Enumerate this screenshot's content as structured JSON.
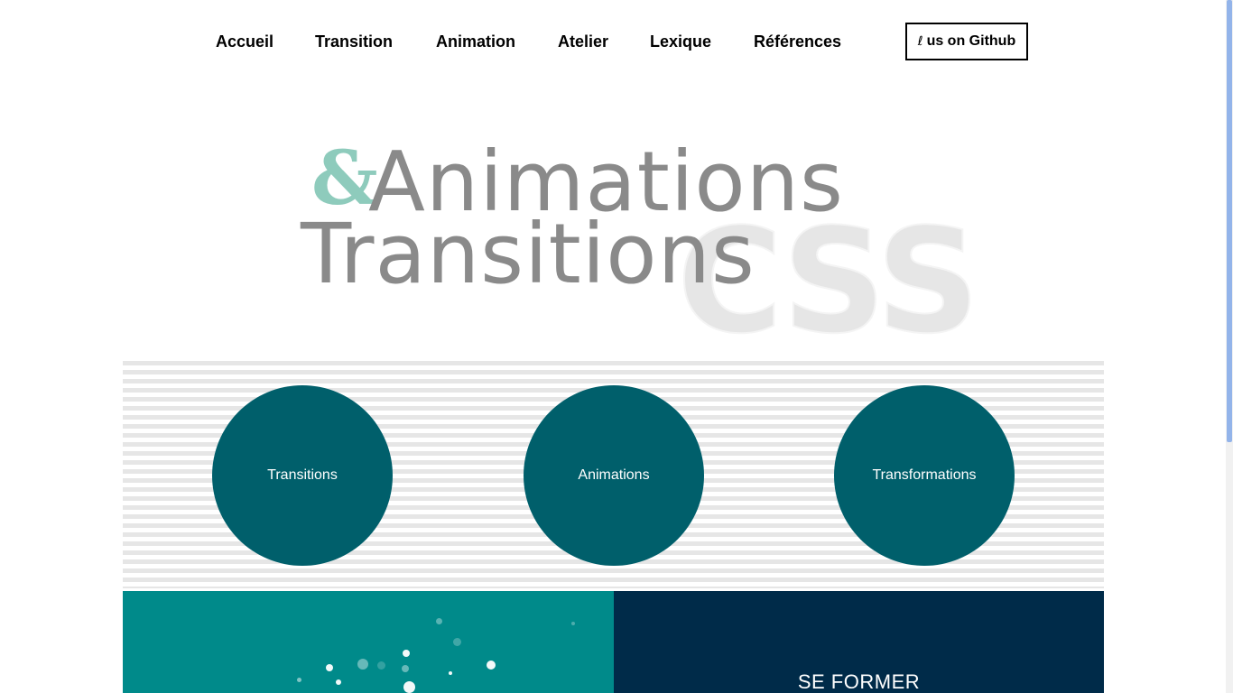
{
  "nav": {
    "items": [
      {
        "label": "Accueil"
      },
      {
        "label": "Transition"
      },
      {
        "label": "Animation"
      },
      {
        "label": "Atelier"
      },
      {
        "label": "Lexique"
      },
      {
        "label": "Références"
      }
    ],
    "github_icon": "fork-icon",
    "github_glyph": "ℓ",
    "github_label": "us on Github"
  },
  "hero": {
    "ampersand": "&",
    "line1": "Animations",
    "line2": "Transitions",
    "watermark": "CSS",
    "ampersand_color": "#8ecbbc",
    "title_color": "#8a8a8a"
  },
  "circles": [
    {
      "label": "Transitions"
    },
    {
      "label": "Animations"
    },
    {
      "label": "Transformations"
    }
  ],
  "colors": {
    "circle": "#005f6b",
    "panel_left": "#008a8a",
    "panel_right": "#002b49"
  },
  "panels": {
    "right_title": "SE FORMER"
  }
}
